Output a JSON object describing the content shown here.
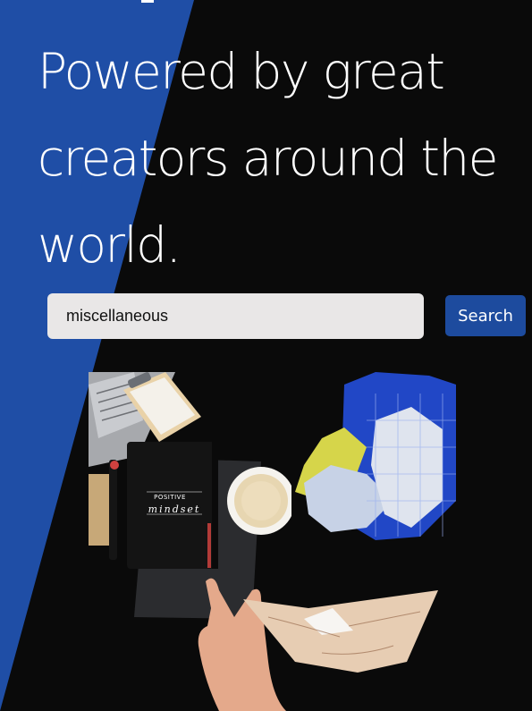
{
  "hero": {
    "title": "Powered by great creators around the world."
  },
  "search": {
    "value": "miscellaneous",
    "button_label": "Search"
  },
  "collage": {
    "notebook_text": "POSITIVE",
    "notebook_script": "mindset"
  },
  "colors": {
    "background": "#0a0a0a",
    "accent_blue": "#1d4b9e",
    "stripe_blue": "#1f4ea6",
    "input_bg": "#e9e7e7"
  }
}
